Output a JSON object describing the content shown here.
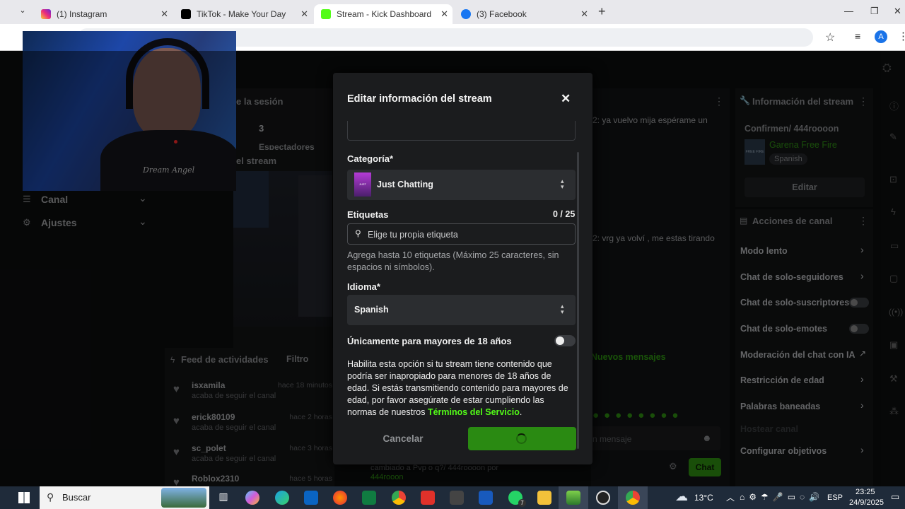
{
  "browser": {
    "tabs": [
      {
        "label": "(1) Instagram",
        "color": "#d62976"
      },
      {
        "label": "TikTok - Make Your Day",
        "color": "#000000"
      },
      {
        "label": "Stream - Kick Dashboard",
        "color": "#53fc18"
      },
      {
        "label": "(3) Facebook",
        "color": "#1877f2"
      }
    ],
    "profile_initial": "A"
  },
  "left_nav": {
    "items": [
      {
        "label": "Canal",
        "icon": "list-icon"
      },
      {
        "label": "Ajustes",
        "icon": "gear-icon"
      }
    ]
  },
  "session": {
    "title": "e la sesión",
    "value": "3",
    "sub_label": "Espectadores"
  },
  "stream_preview": {
    "title": "el stream"
  },
  "activity_feed": {
    "title": "Feed de actividades",
    "filter_label": "Filtro",
    "items": [
      {
        "name": "isxamila",
        "action": "acaba de seguir el canal",
        "time": "hace 18 minutos"
      },
      {
        "name": "erick80109",
        "action": "acaba de seguir el canal",
        "time": "hace 2 horas"
      },
      {
        "name": "sc_polet",
        "action": "acaba de seguir el canal",
        "time": "hace 3 horas"
      },
      {
        "name": "Roblox2310",
        "action": "",
        "time": "hace 5 horas"
      }
    ]
  },
  "chat": {
    "line1": "2: ya vuelvo mija espérame un",
    "line2": "2: vrg ya volví , me estas tirando",
    "new_messages": "Nuevos mensajes",
    "input_placeholder": "n mensaje",
    "send_label": "Chat",
    "footer_line1": "cambiado a Pvp o q?/ 444roooon por",
    "footer_line2": "444rooon"
  },
  "stream_info": {
    "title": "Información del stream",
    "stream_title": "Confirmen/ 444roooon",
    "game": "Garena Free Fire",
    "language_badge": "Spanish",
    "edit_label": "Editar",
    "thumbnail_text": "FREE FIRE"
  },
  "channel_actions": {
    "title": "Acciones de canal",
    "items": [
      {
        "label": "Modo lento",
        "control": "chevron"
      },
      {
        "label": "Chat de solo-seguidores",
        "control": "chevron"
      },
      {
        "label": "Chat de solo-suscriptores",
        "control": "toggle"
      },
      {
        "label": "Chat de solo-emotes",
        "control": "toggle"
      },
      {
        "label": "Moderación del chat con IA",
        "control": "external"
      },
      {
        "label": "Restricción de edad",
        "control": "chevron"
      },
      {
        "label": "Palabras baneadas",
        "control": "chevron"
      },
      {
        "label": "Hostear canal",
        "control": "none"
      },
      {
        "label": "Configurar objetivos",
        "control": "chevron"
      }
    ]
  },
  "modal": {
    "title": "Editar información del stream",
    "category_label": "Categoría*",
    "category_value": "Just Chatting",
    "category_thumb_text": "JUST CHATTING",
    "tags_label": "Etiquetas",
    "tags_count": "0 / 25",
    "tags_placeholder": "Elige tu propia etiqueta",
    "tags_hint": "Agrega hasta 10 etiquetas (Máximo 25 caracteres, sin espacios ni símbolos).",
    "language_label": "Idioma*",
    "language_value": "Spanish",
    "mature_label": "Únicamente para mayores de 18 años",
    "mature_on": false,
    "mature_desc": "Habilita esta opción si tu stream tiene contenido que podría ser inapropiado para menores de 18 años de edad. Si estás transmitiendo contenido para mayores de edad, por favor asegúrate de estar cumpliendo las normas de nuestros",
    "terms_link": "Términos del Servicio",
    "terms_end": ".",
    "cancel_label": "Cancelar",
    "accent": "#53fc18"
  },
  "webcam": {
    "shirt_text": "Dream Angel"
  },
  "taskbar": {
    "search_label": "Buscar",
    "temperature": "13°C",
    "lang": "ESP",
    "time": "23:25",
    "date": "24/9/2025",
    "whatsapp_badge": "7"
  }
}
